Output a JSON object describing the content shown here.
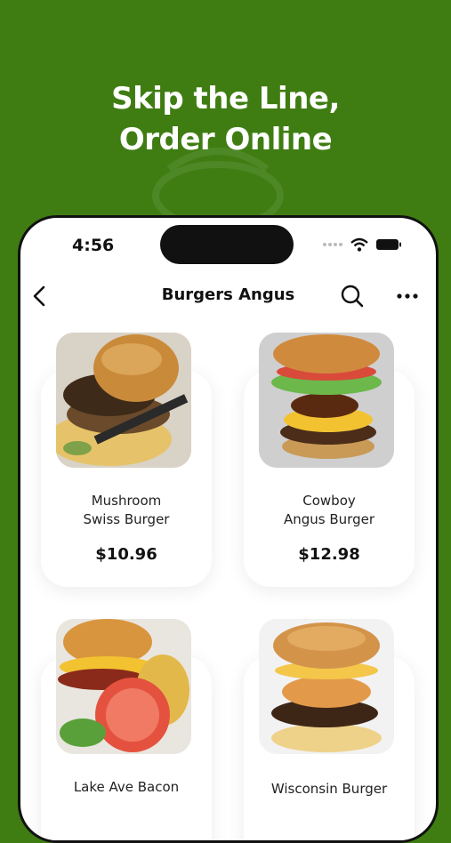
{
  "promo": {
    "headline_line1": "Skip the Line,",
    "headline_line2": "Order Online"
  },
  "status_bar": {
    "time": "4:56",
    "icons": [
      "signal-icon",
      "wifi-icon",
      "battery-icon"
    ]
  },
  "header": {
    "title": "Burgers Angus",
    "icons": [
      "back-icon",
      "search-icon",
      "more-icon"
    ]
  },
  "menu_items": [
    {
      "name_line1": "Mushroom",
      "name_line2": "Swiss Burger",
      "price": "$10.96"
    },
    {
      "name_line1": "Cowboy",
      "name_line2": "Angus Burger",
      "price": "$12.98"
    },
    {
      "name_line1": "Lake Ave Bacon",
      "name_line2": "",
      "price": ""
    },
    {
      "name_line1": "Wisconsin Burger",
      "name_line2": "",
      "price": ""
    }
  ],
  "colors": {
    "background": "#3f7d12",
    "card": "#ffffff",
    "text": "#111111"
  }
}
